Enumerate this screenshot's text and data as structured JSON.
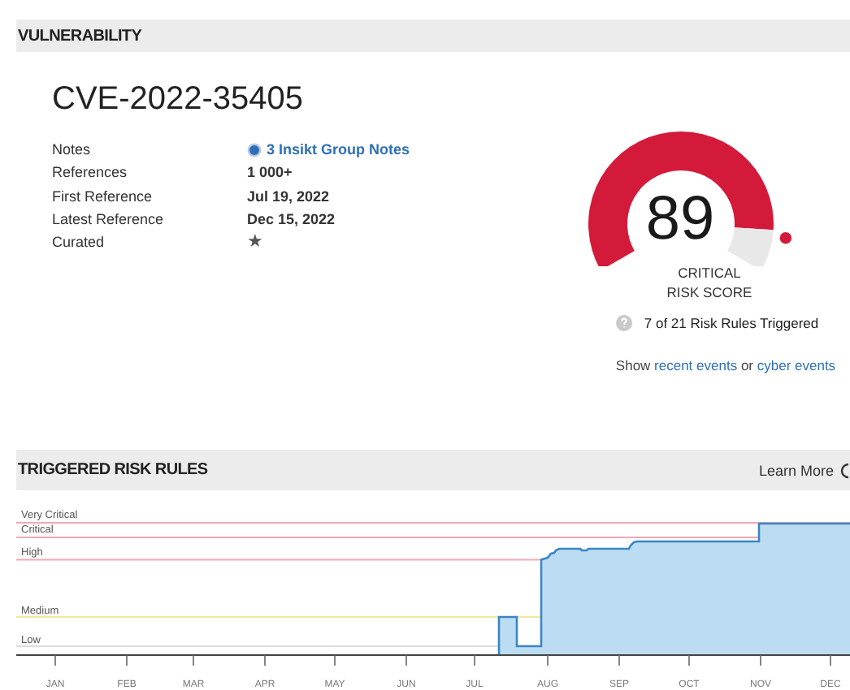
{
  "section_header": {
    "title": "VULNERABILITY"
  },
  "vulnerability": {
    "title": "CVE-2022-35405",
    "fields": [
      {
        "label": "Notes",
        "value": "3 Insikt Group Notes",
        "kind": "link"
      },
      {
        "label": "References",
        "value": "1 000+",
        "kind": "text"
      },
      {
        "label": "First Reference",
        "value": "Jul 19, 2022",
        "kind": "text"
      },
      {
        "label": "Latest Reference",
        "value": "Dec 15, 2022",
        "kind": "text"
      },
      {
        "label": "Curated",
        "value": "★",
        "kind": "star"
      }
    ]
  },
  "risk_score": {
    "score": "89",
    "severity": "CRITICAL",
    "caption": "RISK SCORE",
    "rules_triggered": "7 of 21 Risk Rules Triggered"
  },
  "events_line": {
    "prefix": "Show",
    "first_link": "recent events",
    "joiner": "or",
    "second_link": "cyber events"
  },
  "triggered_risk_rules": {
    "title": "TRIGGERED RISK RULES",
    "action": "Learn More",
    "levels": [
      {
        "label": "Very Critical"
      },
      {
        "label": "Critical"
      },
      {
        "label": "High"
      },
      {
        "label": "Medium"
      },
      {
        "label": "Low"
      }
    ],
    "months": [
      "JAN",
      "FEB",
      "MAR",
      "APR",
      "MAY",
      "JUN",
      "JUL",
      "AUG",
      "SEP",
      "OCT",
      "NOV",
      "DEC"
    ]
  }
}
